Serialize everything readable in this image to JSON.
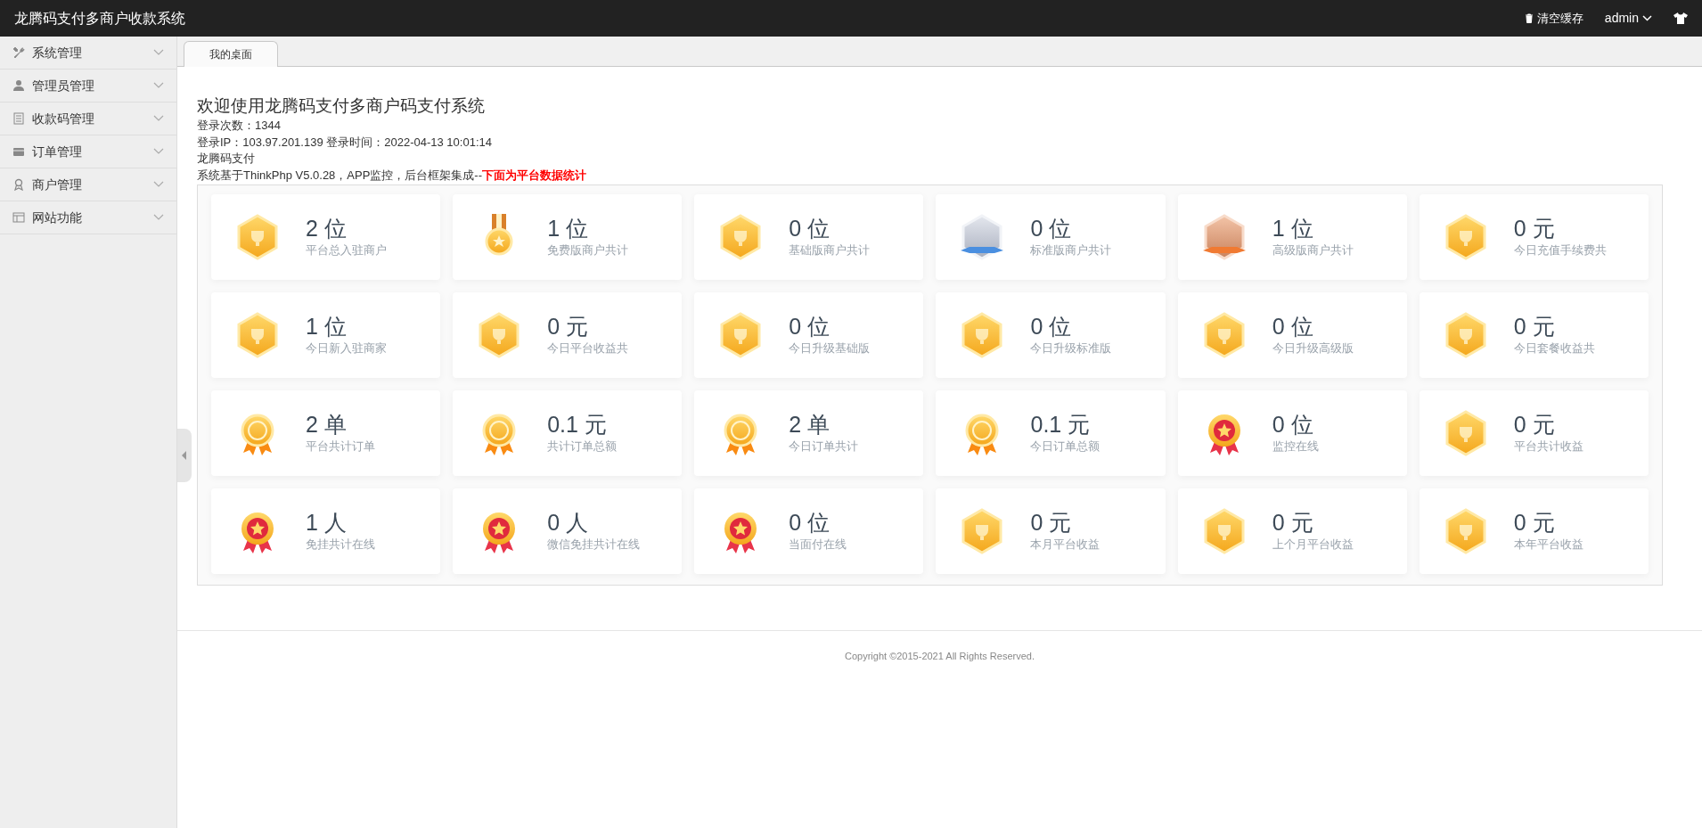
{
  "header": {
    "title": "龙腾码支付多商户收款系统",
    "clear_cache": "清空缓存",
    "user": "admin"
  },
  "sidebar": {
    "items": [
      {
        "label": "系统管理",
        "kind": "tools"
      },
      {
        "label": "管理员管理",
        "kind": "person"
      },
      {
        "label": "收款码管理",
        "kind": "list"
      },
      {
        "label": "订单管理",
        "kind": "card"
      },
      {
        "label": "商户管理",
        "kind": "award"
      },
      {
        "label": "网站功能",
        "kind": "window"
      }
    ]
  },
  "tabs": [
    {
      "label": "我的桌面",
      "selected": true
    }
  ],
  "welcome": {
    "title": "欢迎使用龙腾码支付多商户码支付系统",
    "lines": [
      "登录次数：1344",
      "登录IP：103.97.201.139 登录时间：2022-04-13 10:01:14",
      "龙腾码支付"
    ],
    "note": "系统基于ThinkPhp V5.0.28，APP监控，后台框架集成--",
    "note_highlight": "下面为平台数据统计"
  },
  "stats": [
    {
      "value": "2 位",
      "label": "平台总入驻商户",
      "kind": "gold-hex"
    },
    {
      "value": "1 位",
      "label": "免费版商户共计",
      "kind": "ribbon-medal"
    },
    {
      "value": "0 位",
      "label": "基础版商户共计",
      "kind": "gold-hex"
    },
    {
      "value": "0 位",
      "label": "标准版商户共计",
      "kind": "silver-hex"
    },
    {
      "value": "1 位",
      "label": "高级版商户共计",
      "kind": "bronze-hex"
    },
    {
      "value": "0 元",
      "label": "今日充值手续费共",
      "kind": "gold-hex"
    },
    {
      "value": "1 位",
      "label": "今日新入驻商家",
      "kind": "gold-hex"
    },
    {
      "value": "0 元",
      "label": "今日平台收益共",
      "kind": "gold-hex"
    },
    {
      "value": "0 位",
      "label": "今日升级基础版",
      "kind": "gold-hex"
    },
    {
      "value": "0 位",
      "label": "今日升级标准版",
      "kind": "gold-hex"
    },
    {
      "value": "0 位",
      "label": "今日升级高级版",
      "kind": "gold-hex"
    },
    {
      "value": "0 元",
      "label": "今日套餐收益共",
      "kind": "gold-hex"
    },
    {
      "value": "2 单",
      "label": "平台共计订单",
      "kind": "gold-medal"
    },
    {
      "value": "0.1 元",
      "label": "共计订单总额",
      "kind": "gold-medal"
    },
    {
      "value": "2 单",
      "label": "今日订单共计",
      "kind": "gold-medal"
    },
    {
      "value": "0.1 元",
      "label": "今日订单总额",
      "kind": "gold-medal"
    },
    {
      "value": "0 位",
      "label": "监控在线",
      "kind": "red-medal"
    },
    {
      "value": "0 元",
      "label": "平台共计收益",
      "kind": "gold-hex"
    },
    {
      "value": "1 人",
      "label": "免挂共计在线",
      "kind": "red-medal"
    },
    {
      "value": "0 人",
      "label": "微信免挂共计在线",
      "kind": "red-medal"
    },
    {
      "value": "0 位",
      "label": "当面付在线",
      "kind": "red-medal"
    },
    {
      "value": "0 元",
      "label": "本月平台收益",
      "kind": "gold-hex"
    },
    {
      "value": "0 元",
      "label": "上个月平台收益",
      "kind": "gold-hex"
    },
    {
      "value": "0 元",
      "label": "本年平台收益",
      "kind": "gold-hex"
    }
  ],
  "footer": {
    "copyright": "Copyright ©2015-2021 All Rights Reserved."
  }
}
